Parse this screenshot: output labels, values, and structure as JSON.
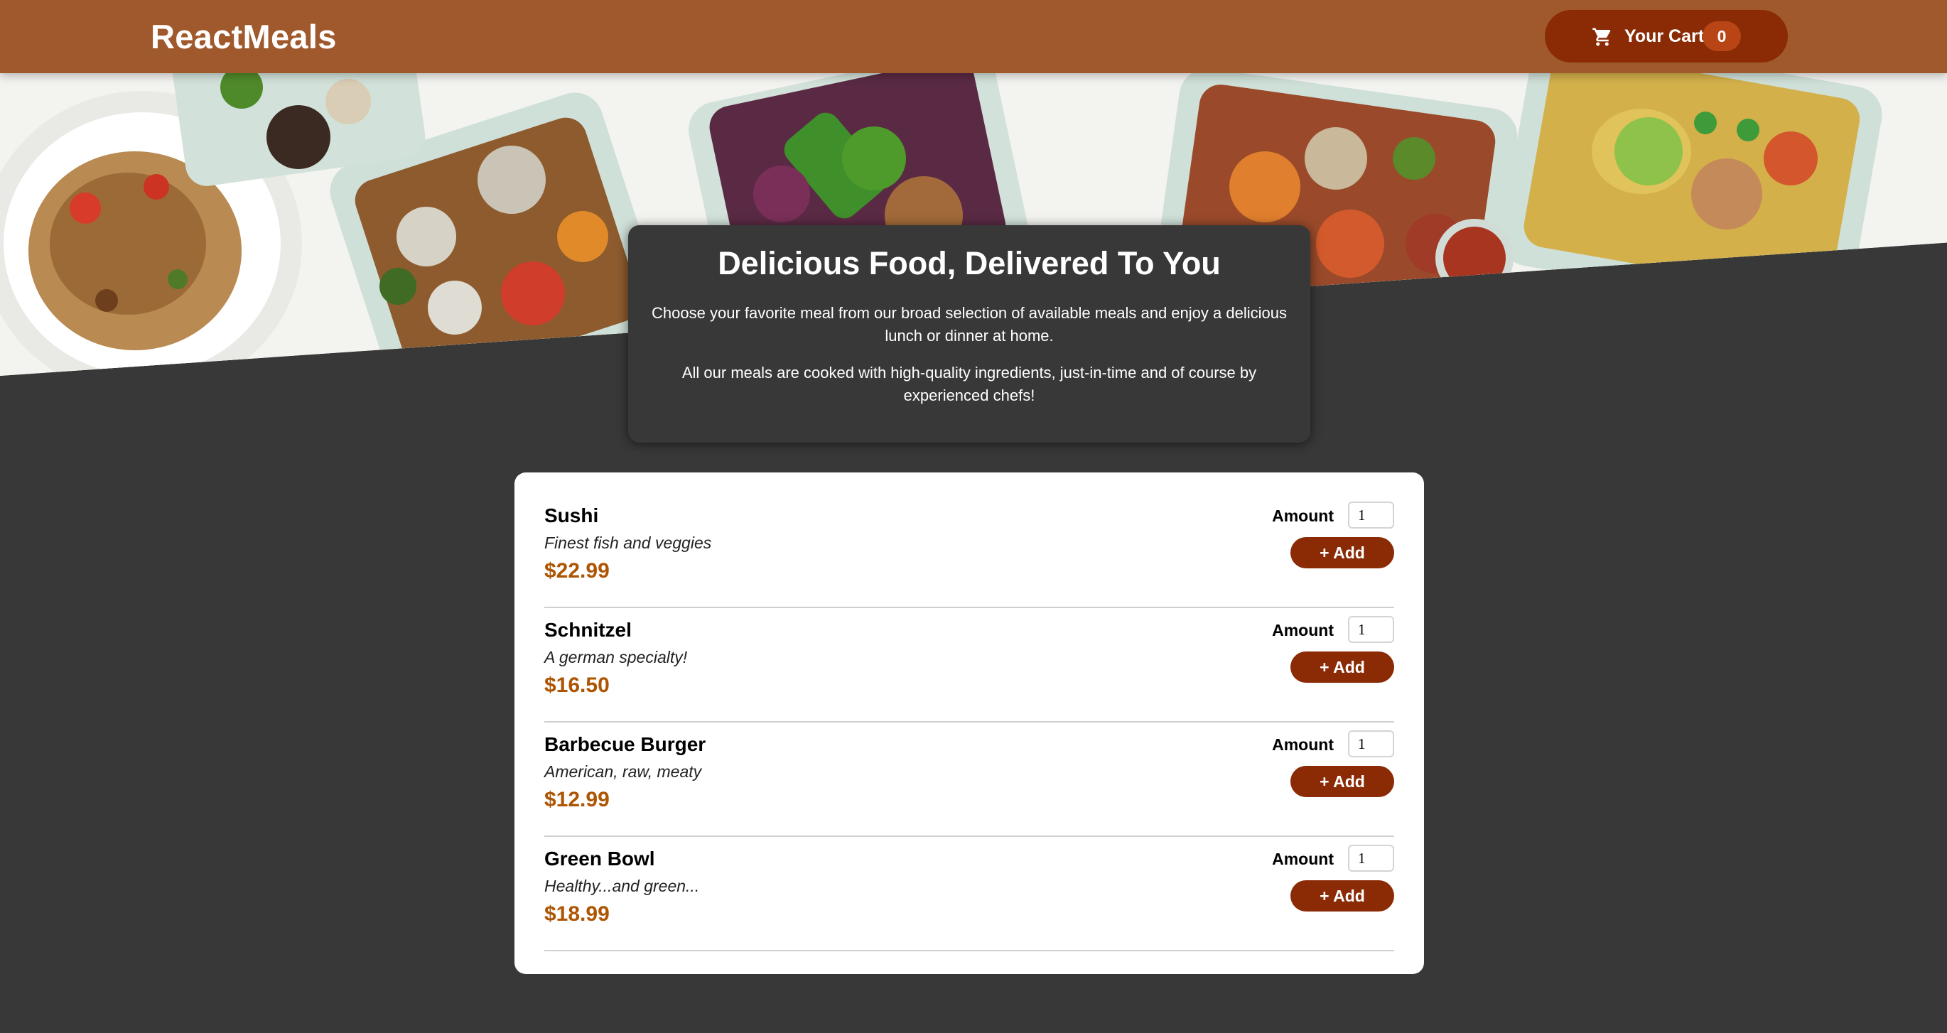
{
  "header": {
    "logo": "ReactMeals",
    "cart_label": "Your Cart",
    "cart_count": "0",
    "cart_icon": "cart-icon",
    "colors": {
      "bar": "#a0592c",
      "button": "#8a2b06",
      "badge": "#b94517"
    }
  },
  "summary": {
    "title": "Delicious Food, Delivered To You",
    "paragraph_1": "Choose your favorite meal from our broad selection of available meals and enjoy a delicious lunch or dinner at home.",
    "paragraph_2": "All our meals are cooked with high-quality ingredients, just-in-time and of course by experienced chefs!"
  },
  "meals": [
    {
      "name": "Sushi",
      "description": "Finest fish and veggies",
      "price": "$22.99",
      "amount_label": "Amount",
      "amount_value": "1",
      "add_label": "+ Add"
    },
    {
      "name": "Schnitzel",
      "description": "A german specialty!",
      "price": "$16.50",
      "amount_label": "Amount",
      "amount_value": "1",
      "add_label": "+ Add"
    },
    {
      "name": "Barbecue Burger",
      "description": "American, raw, meaty",
      "price": "$12.99",
      "amount_label": "Amount",
      "amount_value": "1",
      "add_label": "+ Add"
    },
    {
      "name": "Green Bowl",
      "description": "Healthy...and green...",
      "price": "$18.99",
      "amount_label": "Amount",
      "amount_value": "1",
      "add_label": "+ Add"
    }
  ],
  "colors": {
    "page_background": "#383838",
    "price": "#ad5502",
    "card": "#ffffff"
  }
}
